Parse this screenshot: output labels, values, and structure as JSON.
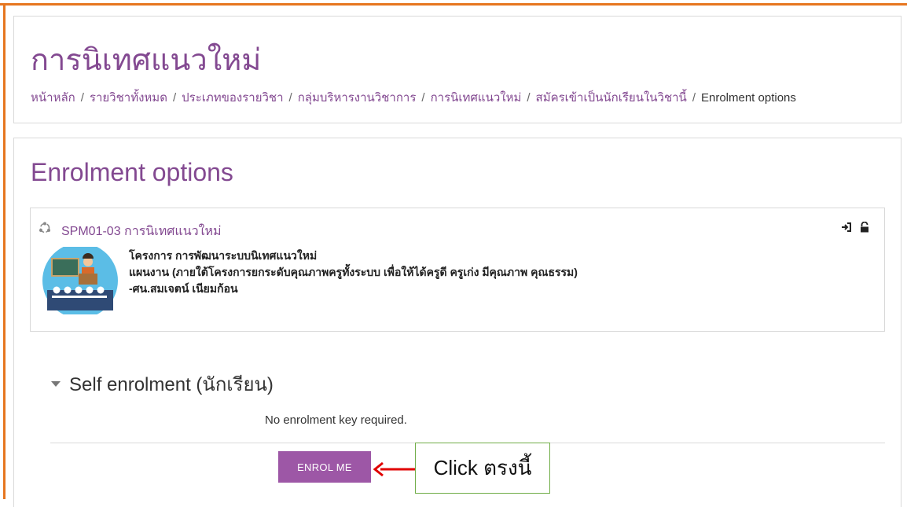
{
  "header": {
    "title": "การนิเทศแนวใหม่",
    "breadcrumb": [
      {
        "label": "หน้าหลัก"
      },
      {
        "label": "รายวิชาทั้งหมด"
      },
      {
        "label": "ประเภทของรายวิชา"
      },
      {
        "label": "กลุ่มบริหารงานวิชาการ"
      },
      {
        "label": "การนิเทศแนวใหม่"
      },
      {
        "label": "สมัครเข้าเป็นนักเรียนในวิชานี้"
      }
    ],
    "breadcrumb_current": "Enrolment options",
    "separator": "/"
  },
  "main": {
    "heading": "Enrolment options",
    "course": {
      "icon": "course-icon",
      "name": "SPM01-03 การนิเทศแนวใหม่",
      "summary_lines": [
        "โครงการ การพัฒนาระบบนิเทศแนวใหม่",
        "แผนงาน (ภายใต้โครงการยกระดับคุณภาพครูทั้งระบบ เพื่อให้ได้ครูดี ครูเก่ง มีคุณภาพ คุณธรรม)",
        " -ศน.สมเจตน์  เนียมก้อน"
      ],
      "enrol_icons": [
        "enrol-login-icon",
        "unlock-icon"
      ]
    },
    "self_enrolment": {
      "heading": "Self enrolment (นักเรียน)",
      "message": "No enrolment key required.",
      "button_label": "ENROL ME"
    }
  },
  "annotation": {
    "callout_text": "Click ตรงนี้",
    "arrow_color": "#e00000",
    "border_color": "#70ad47"
  },
  "colors": {
    "accent": "#834991",
    "button": "#9d57a6",
    "frame": "#e6761f"
  }
}
